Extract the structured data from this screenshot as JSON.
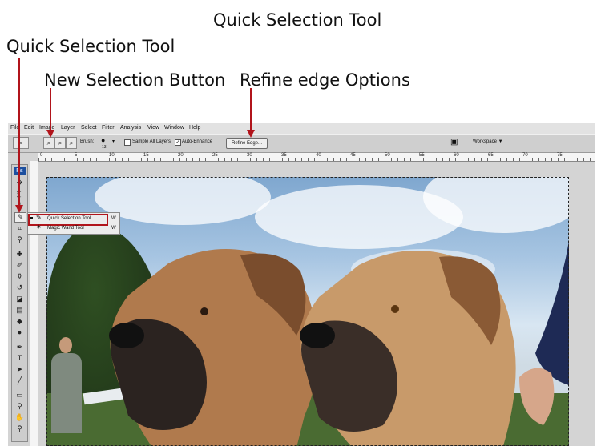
{
  "annotations": {
    "title": "Quick Selection Tool",
    "left_label": "Quick Selection Tool",
    "new_selection_label": "New Selection Button",
    "refine_label": "Refine edge Options"
  },
  "menu": [
    "File",
    "Edit",
    "Image",
    "Layer",
    "Select",
    "Filter",
    "Analysis",
    "View",
    "Window",
    "Help"
  ],
  "options_bar": {
    "brush_label": "Brush:",
    "brush_size": "13",
    "sample_all_layers": "Sample All Layers",
    "auto_enhance": "Auto-Enhance",
    "refine_edge": "Refine Edge...",
    "workspace": "Workspace ▼"
  },
  "ruler_ticks": [
    "0",
    "5",
    "10",
    "15",
    "20",
    "25",
    "30",
    "35",
    "40",
    "45",
    "50",
    "55",
    "60",
    "65",
    "70",
    "75"
  ],
  "toolbar": {
    "logo": "Ps"
  },
  "flyout": {
    "items": [
      {
        "name": "Quick Selection Tool",
        "key": "W"
      },
      {
        "name": "Magic Wand Tool",
        "key": "W"
      }
    ]
  },
  "colors": {
    "arrow": "#b1141b",
    "ps_blue": "#1c4f9f"
  }
}
